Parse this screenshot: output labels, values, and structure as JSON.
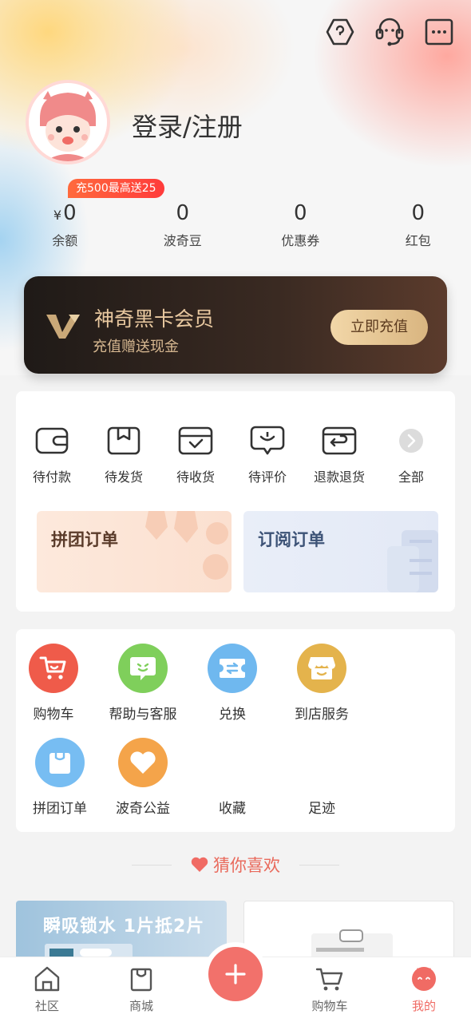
{
  "header": {
    "login_label": "登录/注册"
  },
  "promo": {
    "badge": "充500最高送25"
  },
  "stats": [
    {
      "currency": "¥",
      "value": "0",
      "label": "余额"
    },
    {
      "currency": "",
      "value": "0",
      "label": "波奇豆"
    },
    {
      "currency": "",
      "value": "0",
      "label": "优惠券"
    },
    {
      "currency": "",
      "value": "0",
      "label": "红包"
    }
  ],
  "vip": {
    "title": "神奇黑卡会员",
    "subtitle": "充值赠送现金",
    "button": "立即充值"
  },
  "orders": {
    "items": [
      {
        "label": "待付款",
        "icon": "wallet-icon"
      },
      {
        "label": "待发货",
        "icon": "package-icon"
      },
      {
        "label": "待收货",
        "icon": "box-check-icon"
      },
      {
        "label": "待评价",
        "icon": "comment-icon"
      },
      {
        "label": "退款退货",
        "icon": "return-icon"
      },
      {
        "label": "全部",
        "icon": "chevron-right-icon"
      }
    ],
    "group_order": "拼团订单",
    "subscribe_order": "订阅订单"
  },
  "services": [
    {
      "label": "购物车",
      "color": "#ef5b4a",
      "icon": "cart-icon"
    },
    {
      "label": "帮助与客服",
      "color": "#7fcf5b",
      "icon": "chat-icon"
    },
    {
      "label": "兑换",
      "color": "#6fb8ef",
      "icon": "exchange-icon"
    },
    {
      "label": "到店服务",
      "color": "#e4b34c",
      "icon": "store-icon"
    },
    {
      "label": "拼团订单",
      "color": "#77bdf2",
      "icon": "bag-icon"
    },
    {
      "label": "波奇公益",
      "color": "#f4a44a",
      "icon": "heart-icon"
    },
    {
      "label": "收藏",
      "color": "",
      "icon": ""
    },
    {
      "label": "足迹",
      "color": "",
      "icon": ""
    }
  ],
  "guess": {
    "title": "猜你喜欢"
  },
  "products": [
    {
      "title": "瞬吸锁水 1片抵2片"
    }
  ],
  "nav": [
    {
      "label": "社区",
      "icon": "home-icon"
    },
    {
      "label": "商城",
      "icon": "shopping-bag-icon"
    },
    {
      "label": "购物车",
      "icon": "cart-icon"
    },
    {
      "label": "我的",
      "icon": "profile-face-icon"
    }
  ],
  "colors": {
    "accent": "#f06b64",
    "vip_gold": "#e9c9a0"
  }
}
